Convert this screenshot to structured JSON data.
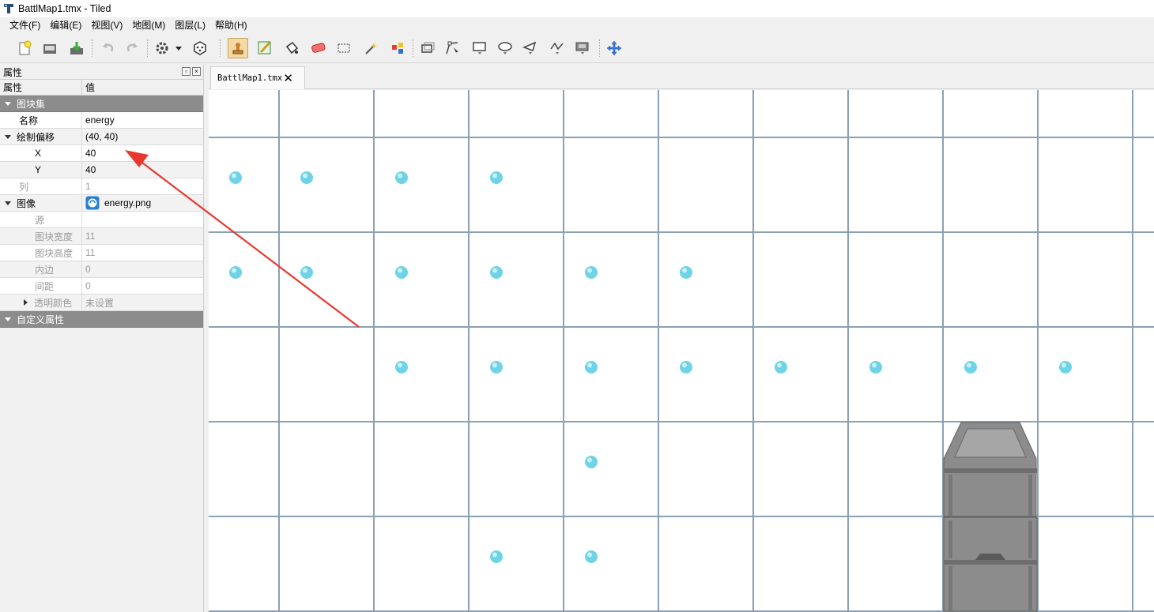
{
  "window": {
    "title": "BattlMap1.tmx - Tiled"
  },
  "menu": [
    "文件(F)",
    "编辑(E)",
    "视图(V)",
    "地图(M)",
    "图层(L)",
    "帮助(H)"
  ],
  "toolbar": {
    "buttons": [
      "new-icon",
      "open-icon",
      "save-icon",
      "undo-icon",
      "redo-icon",
      "commands-icon",
      "random-icon",
      "stamp-brush-icon",
      "terrain-brush-icon",
      "bucket-fill-icon",
      "eraser-icon",
      "rect-select-icon",
      "magic-wand-icon",
      "select-same-tile-icon",
      "select-objects-icon",
      "edit-polygons-icon",
      "insert-rectangle-icon",
      "insert-ellipse-icon",
      "insert-polygon-icon",
      "insert-polyline-icon",
      "insert-tile-icon",
      "move-icon"
    ],
    "active": "stamp-brush-icon"
  },
  "properties": {
    "panel_title": "属性",
    "header_name": "属性",
    "header_value": "值",
    "groups": {
      "tileset": "图块集",
      "custom": "自定义属性"
    },
    "rows": {
      "name_label": "名称",
      "name_value": "energy",
      "offset_label": "绘制偏移",
      "offset_value": "(40, 40)",
      "x_label": "X",
      "x_value": "40",
      "y_label": "Y",
      "y_value": "40",
      "columns_label": "列",
      "columns_value": "1",
      "image_label": "图像",
      "image_value": "energy.png",
      "source_label": "源",
      "source_value": "",
      "tile_width_label": "图块宽度",
      "tile_width_value": "11",
      "tile_height_label": "图块高度",
      "tile_height_value": "11",
      "margin_label": "内边",
      "margin_value": "0",
      "spacing_label": "间距",
      "spacing_value": "0",
      "transparent_label": "透明颜色",
      "transparent_value": "未设置"
    }
  },
  "tabs": [
    {
      "label": "BattlMap1.tmx",
      "active": true
    }
  ],
  "map": {
    "energy_tiles": [
      [
        1,
        0
      ],
      [
        1,
        1
      ],
      [
        1,
        2
      ],
      [
        1,
        3
      ],
      [
        2,
        0
      ],
      [
        2,
        1
      ],
      [
        2,
        2
      ],
      [
        2,
        3
      ],
      [
        2,
        4
      ],
      [
        2,
        5
      ],
      [
        3,
        2
      ],
      [
        3,
        3
      ],
      [
        3,
        4
      ],
      [
        3,
        5
      ],
      [
        3,
        6
      ],
      [
        3,
        7
      ],
      [
        3,
        8
      ],
      [
        3,
        9
      ],
      [
        4,
        4
      ],
      [
        5,
        3
      ],
      [
        5,
        4
      ]
    ],
    "building_tile_rows": [
      4,
      5
    ],
    "building_tile_col": 7,
    "colors": {
      "energy": "#6fd3e6",
      "grid": "#8aa0b4",
      "building": "#8a8a8a",
      "annotation": "#e8382e"
    }
  }
}
